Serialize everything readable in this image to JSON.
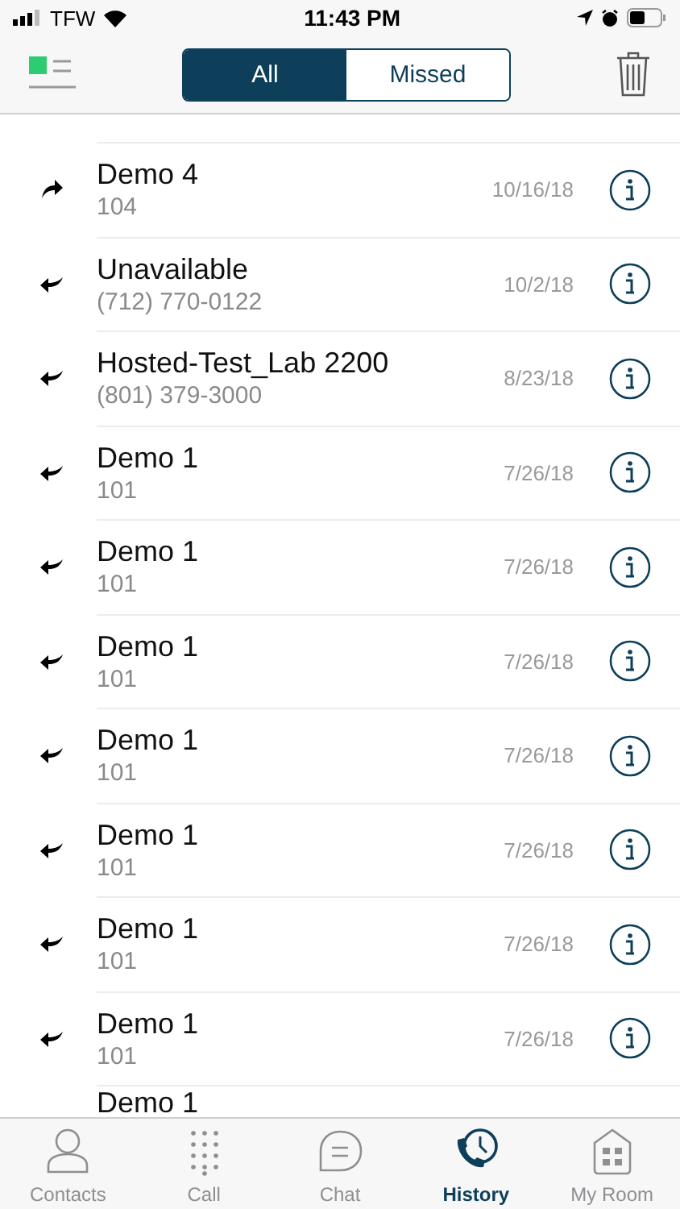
{
  "status_bar": {
    "carrier": "TFW",
    "time": "11:43 PM"
  },
  "segments": [
    {
      "label": "All",
      "selected": true
    },
    {
      "label": "Missed",
      "selected": false
    }
  ],
  "calls": [
    {
      "kind": "outgoing",
      "name": "Demo 4",
      "number": "104",
      "date": "10/16/18"
    },
    {
      "kind": "incoming",
      "name": "Unavailable",
      "number": "(712) 770-0122",
      "date": "10/2/18"
    },
    {
      "kind": "incoming",
      "name": "Hosted-Test_Lab 2200",
      "number": "(801) 379-3000",
      "date": "8/23/18"
    },
    {
      "kind": "incoming",
      "name": "Demo 1",
      "number": "101",
      "date": "7/26/18"
    },
    {
      "kind": "incoming",
      "name": "Demo 1",
      "number": "101",
      "date": "7/26/18"
    },
    {
      "kind": "incoming",
      "name": "Demo 1",
      "number": "101",
      "date": "7/26/18"
    },
    {
      "kind": "incoming",
      "name": "Demo 1",
      "number": "101",
      "date": "7/26/18"
    },
    {
      "kind": "incoming",
      "name": "Demo 1",
      "number": "101",
      "date": "7/26/18"
    },
    {
      "kind": "incoming",
      "name": "Demo 1",
      "number": "101",
      "date": "7/26/18"
    },
    {
      "kind": "incoming",
      "name": "Demo 1",
      "number": "101",
      "date": "7/26/18"
    },
    {
      "kind": "cut",
      "name": "Demo 1"
    }
  ],
  "tab_bar": [
    {
      "kind": "contacts",
      "label": "Contacts",
      "selected": false
    },
    {
      "kind": "call",
      "label": "Call",
      "selected": false
    },
    {
      "kind": "chat",
      "label": "Chat",
      "selected": false
    },
    {
      "kind": "history",
      "label": "History",
      "selected": true
    },
    {
      "kind": "room",
      "label": "My Room",
      "selected": false
    }
  ]
}
